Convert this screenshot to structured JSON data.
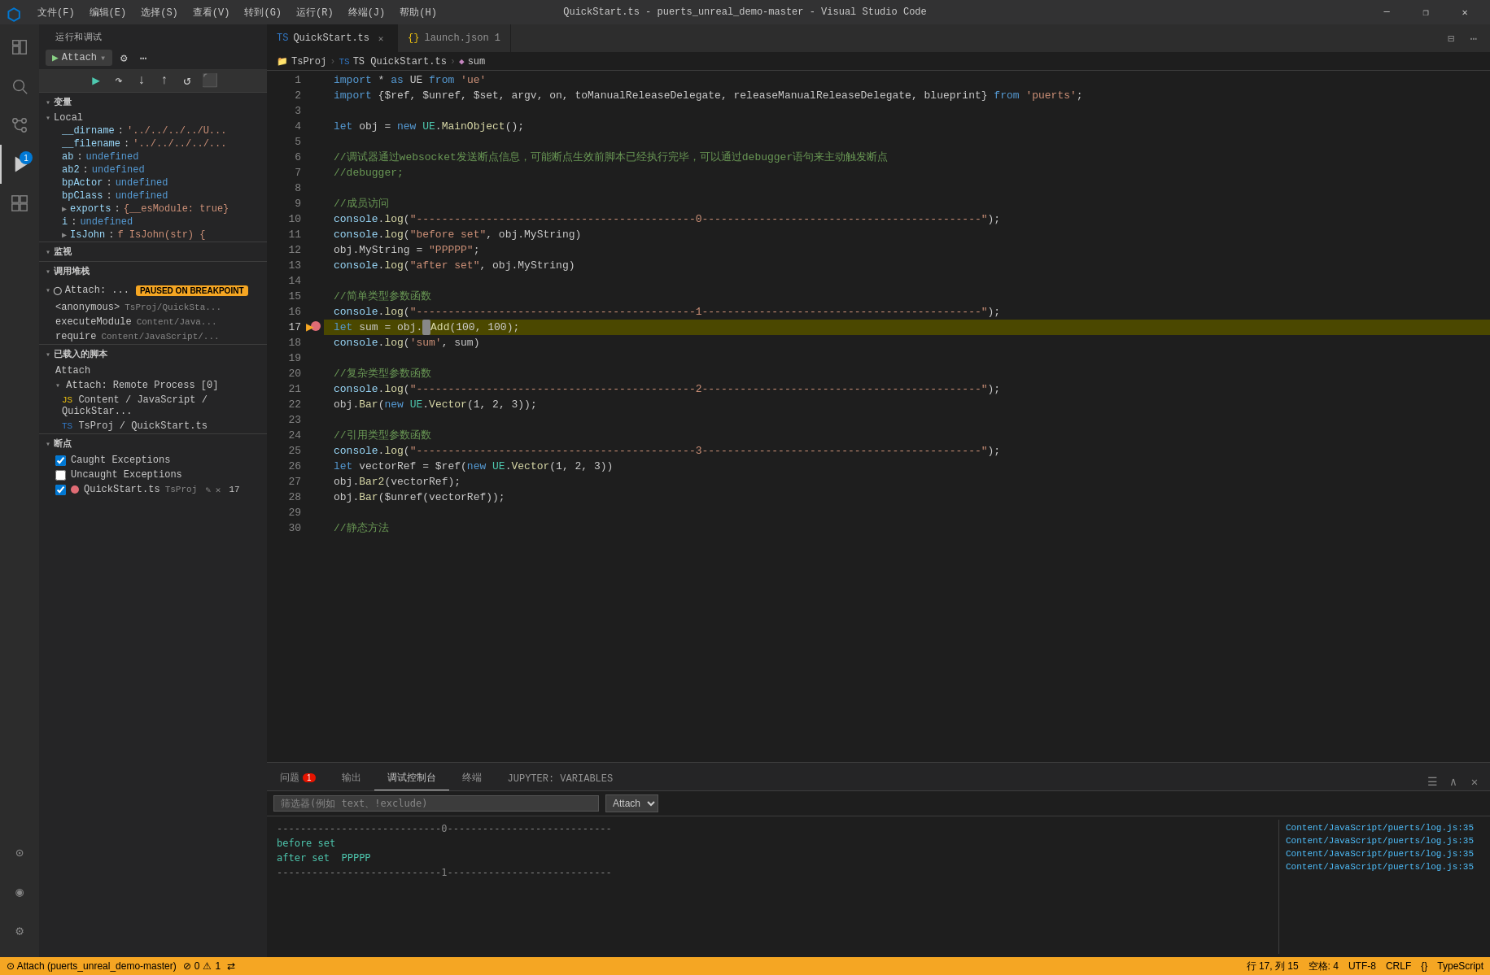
{
  "titleBar": {
    "title": "QuickStart.ts - puerts_unreal_demo-master - Visual Studio Code",
    "logo": "⬡",
    "menus": [
      "文件(F)",
      "编辑(E)",
      "选择(S)",
      "查看(V)",
      "转到(G)",
      "运行(R)",
      "终端(J)",
      "帮助(H)"
    ],
    "windowButtons": [
      "─",
      "❐",
      "✕"
    ]
  },
  "activityBar": {
    "icons": [
      {
        "name": "explorer-icon",
        "symbol": "⎘",
        "active": false
      },
      {
        "name": "search-icon",
        "symbol": "🔍",
        "active": false
      },
      {
        "name": "source-control-icon",
        "symbol": "⑂",
        "active": false
      },
      {
        "name": "run-debug-icon",
        "symbol": "▷",
        "active": true,
        "badge": "1"
      },
      {
        "name": "extensions-icon",
        "symbol": "⊞",
        "active": false
      }
    ],
    "bottomIcons": [
      {
        "name": "remote-icon",
        "symbol": "⊙"
      },
      {
        "name": "account-icon",
        "symbol": "◉"
      },
      {
        "name": "settings-icon",
        "symbol": "⚙"
      }
    ]
  },
  "sidebar": {
    "header": "运行和调试",
    "debugConfig": {
      "label": "Attach",
      "gearIcon": "⚙",
      "moreIcon": "⋯",
      "runIcon": "▶",
      "addIcon": "+"
    },
    "variables": {
      "sectionLabel": "变量",
      "local": {
        "label": "Local",
        "items": [
          {
            "name": "__dirname",
            "value": "'../../../../U..."
          },
          {
            "name": "__filename",
            "value": "'../../../../..."
          },
          {
            "name": "ab",
            "value": "undefined"
          },
          {
            "name": "ab2",
            "value": "undefined"
          },
          {
            "name": "bpActor",
            "value": "undefined"
          },
          {
            "name": "bpClass",
            "value": "undefined"
          },
          {
            "name": "exports",
            "value": "{__esModule: true}"
          },
          {
            "name": "i",
            "value": "undefined"
          },
          {
            "name": "IsJohn",
            "value": "f IsJohn(str) {"
          }
        ]
      }
    },
    "watch": {
      "sectionLabel": "监视"
    },
    "callStack": {
      "sectionLabel": "调用堆栈",
      "attach": {
        "label": "Attach:",
        "sublabel": "...",
        "badge": "PAUSED ON BREAKPOINT"
      },
      "frames": [
        {
          "name": "<anonymous>",
          "loc": "TsProj/QuickSta..."
        },
        {
          "name": "executeModule",
          "loc": "Content/Java..."
        },
        {
          "name": "require",
          "loc": "Content/JavaScript/..."
        }
      ]
    },
    "scriptsLoaded": {
      "sectionLabel": "已载入的脚本",
      "items": [
        {
          "label": "Attach",
          "indent": false
        },
        {
          "label": "Attach: Remote Process [0]",
          "indent": false,
          "expandable": true
        },
        {
          "label": "Content / JavaScript / QuickStar...",
          "indent": true,
          "icon": "JS"
        },
        {
          "label": "TsProj / QuickStart.ts",
          "indent": true,
          "icon": "TS"
        }
      ]
    },
    "breakpoints": {
      "sectionLabel": "断点",
      "items": [
        {
          "label": "Caught Exceptions",
          "checked": true
        },
        {
          "label": "Uncaught Exceptions",
          "checked": false
        },
        {
          "label": "QuickStart.ts  TsProj",
          "checked": true,
          "dot": true,
          "line": "17",
          "editIcon": "✎",
          "closeIcon": "✕"
        }
      ]
    }
  },
  "editor": {
    "tabs": [
      {
        "label": "QuickStart.ts",
        "type": "ts",
        "active": true,
        "dirty": false
      },
      {
        "label": "launch.json 1",
        "type": "json",
        "active": false,
        "dirty": false
      }
    ],
    "breadcrumb": [
      {
        "label": "TsProj"
      },
      {
        "label": "TS QuickStart.ts"
      },
      {
        "label": "sum",
        "icon": "◆"
      }
    ],
    "lines": [
      {
        "num": 1,
        "tokens": [
          {
            "t": "kw",
            "v": "import"
          },
          {
            "t": "punct",
            "v": " * "
          },
          {
            "t": "kw",
            "v": "as"
          },
          {
            "t": "punct",
            "v": " UE "
          },
          {
            "t": "kw",
            "v": "from"
          },
          {
            "t": "punct",
            "v": " "
          },
          {
            "t": "str",
            "v": "'ue'"
          }
        ]
      },
      {
        "num": 2,
        "tokens": [
          {
            "t": "kw",
            "v": "import"
          },
          {
            "t": "punct",
            "v": " {$ref, $unref, $set, argv, on, toManualReleaseDelegate, releaseManualReleaseDelegate, blueprint} "
          },
          {
            "t": "kw",
            "v": "from"
          },
          {
            "t": "punct",
            "v": " "
          },
          {
            "t": "str",
            "v": "'puerts'"
          },
          {
            "t": "punct",
            "v": ";"
          }
        ]
      },
      {
        "num": 3,
        "tokens": []
      },
      {
        "num": 4,
        "tokens": [
          {
            "t": "kw",
            "v": "let"
          },
          {
            "t": "punct",
            "v": " obj = "
          },
          {
            "t": "kw",
            "v": "new"
          },
          {
            "t": "punct",
            "v": " "
          },
          {
            "t": "type-ref",
            "v": "UE"
          },
          {
            "t": "punct",
            "v": "."
          },
          {
            "t": "fn",
            "v": "MainObject"
          },
          {
            "t": "punct",
            "v": "();"
          }
        ]
      },
      {
        "num": 5,
        "tokens": []
      },
      {
        "num": 6,
        "tokens": [
          {
            "t": "comment",
            "v": "//调试器通过websocket发送断点信息，可能断点生效前脚本已经执行完毕，可以通过debugger语句来主动触发断点"
          }
        ]
      },
      {
        "num": 7,
        "tokens": [
          {
            "t": "comment",
            "v": "//debugger;"
          }
        ]
      },
      {
        "num": 8,
        "tokens": []
      },
      {
        "num": 9,
        "tokens": [
          {
            "t": "comment",
            "v": "//成员访问"
          }
        ]
      },
      {
        "num": 10,
        "tokens": [
          {
            "t": "var-ref",
            "v": "console"
          },
          {
            "t": "punct",
            "v": "."
          },
          {
            "t": "fn",
            "v": "log"
          },
          {
            "t": "punct",
            "v": "("
          },
          {
            "t": "str",
            "v": "\"--------------------------------------------0--------------------------------------------\""
          },
          {
            "t": "punct",
            "v": ");"
          }
        ]
      },
      {
        "num": 11,
        "tokens": [
          {
            "t": "var-ref",
            "v": "console"
          },
          {
            "t": "punct",
            "v": "."
          },
          {
            "t": "fn",
            "v": "log"
          },
          {
            "t": "punct",
            "v": "("
          },
          {
            "t": "str",
            "v": "\"before set\""
          },
          {
            "t": "punct",
            "v": ", obj.MyString)"
          }
        ]
      },
      {
        "num": 12,
        "tokens": [
          {
            "t": "punct",
            "v": "obj.MyString = "
          },
          {
            "t": "str",
            "v": "\"PPPPP\""
          },
          {
            "t": "punct",
            "v": ";"
          }
        ]
      },
      {
        "num": 13,
        "tokens": [
          {
            "t": "var-ref",
            "v": "console"
          },
          {
            "t": "punct",
            "v": "."
          },
          {
            "t": "fn",
            "v": "log"
          },
          {
            "t": "punct",
            "v": "("
          },
          {
            "t": "str",
            "v": "\"after set\""
          },
          {
            "t": "punct",
            "v": ", obj.MyString)"
          }
        ]
      },
      {
        "num": 14,
        "tokens": []
      },
      {
        "num": 15,
        "tokens": [
          {
            "t": "comment",
            "v": "//简单类型参数函数"
          }
        ]
      },
      {
        "num": 16,
        "tokens": [
          {
            "t": "var-ref",
            "v": "console"
          },
          {
            "t": "punct",
            "v": "."
          },
          {
            "t": "fn",
            "v": "log"
          },
          {
            "t": "punct",
            "v": "("
          },
          {
            "t": "str",
            "v": "\"--------------------------------------------1--------------------------------------------\""
          },
          {
            "t": "punct",
            "v": ");"
          }
        ]
      },
      {
        "num": 17,
        "tokens": [
          {
            "t": "kw",
            "v": "let"
          },
          {
            "t": "punct",
            "v": " sum = obj."
          },
          {
            "t": "fn",
            "v": "Add"
          },
          {
            "t": "punct",
            "v": "(100, 100);"
          }
        ],
        "current": true,
        "debugArrow": true
      },
      {
        "num": 18,
        "tokens": [
          {
            "t": "var-ref",
            "v": "console"
          },
          {
            "t": "punct",
            "v": "."
          },
          {
            "t": "fn",
            "v": "log"
          },
          {
            "t": "punct",
            "v": "("
          },
          {
            "t": "str",
            "v": "'sum'"
          },
          {
            "t": "punct",
            "v": ", sum)"
          }
        ]
      },
      {
        "num": 19,
        "tokens": []
      },
      {
        "num": 20,
        "tokens": [
          {
            "t": "comment",
            "v": "//复杂类型参数函数"
          }
        ]
      },
      {
        "num": 21,
        "tokens": [
          {
            "t": "var-ref",
            "v": "console"
          },
          {
            "t": "punct",
            "v": "."
          },
          {
            "t": "fn",
            "v": "log"
          },
          {
            "t": "punct",
            "v": "("
          },
          {
            "t": "str",
            "v": "\"--------------------------------------------2--------------------------------------------\""
          },
          {
            "t": "punct",
            "v": ");"
          }
        ]
      },
      {
        "num": 22,
        "tokens": [
          {
            "t": "punct",
            "v": "obj."
          },
          {
            "t": "fn",
            "v": "Bar"
          },
          {
            "t": "punct",
            "v": "("
          },
          {
            "t": "kw",
            "v": "new"
          },
          {
            "t": "punct",
            "v": " "
          },
          {
            "t": "type-ref",
            "v": "UE"
          },
          {
            "t": "punct",
            "v": "."
          },
          {
            "t": "fn",
            "v": "Vector"
          },
          {
            "t": "punct",
            "v": "(1, 2, 3));"
          }
        ]
      },
      {
        "num": 23,
        "tokens": []
      },
      {
        "num": 24,
        "tokens": [
          {
            "t": "comment",
            "v": "//引用类型参数函数"
          }
        ]
      },
      {
        "num": 25,
        "tokens": [
          {
            "t": "var-ref",
            "v": "console"
          },
          {
            "t": "punct",
            "v": "."
          },
          {
            "t": "fn",
            "v": "log"
          },
          {
            "t": "punct",
            "v": "("
          },
          {
            "t": "str",
            "v": "\"--------------------------------------------3--------------------------------------------\""
          },
          {
            "t": "punct",
            "v": ");"
          }
        ]
      },
      {
        "num": 26,
        "tokens": [
          {
            "t": "kw",
            "v": "let"
          },
          {
            "t": "punct",
            "v": " vectorRef = $ref("
          },
          {
            "t": "kw",
            "v": "new"
          },
          {
            "t": "punct",
            "v": " "
          },
          {
            "t": "type-ref",
            "v": "UE"
          },
          {
            "t": "punct",
            "v": "."
          },
          {
            "t": "fn",
            "v": "Vector"
          },
          {
            "t": "punct",
            "v": "(1, 2, 3))"
          }
        ]
      },
      {
        "num": 27,
        "tokens": [
          {
            "t": "punct",
            "v": "obj."
          },
          {
            "t": "fn",
            "v": "Bar2"
          },
          {
            "t": "punct",
            "v": "(vectorRef);"
          }
        ]
      },
      {
        "num": 28,
        "tokens": [
          {
            "t": "punct",
            "v": "obj."
          },
          {
            "t": "fn",
            "v": "Bar"
          },
          {
            "t": "punct",
            "v": "($unref(vectorRef));"
          }
        ]
      },
      {
        "num": 29,
        "tokens": []
      },
      {
        "num": 30,
        "tokens": [
          {
            "t": "comment",
            "v": "//静态方法"
          }
        ]
      }
    ]
  },
  "panel": {
    "tabs": [
      {
        "label": "问题",
        "badge": "1",
        "active": false
      },
      {
        "label": "输出",
        "active": false
      },
      {
        "label": "调试控制台",
        "active": true
      },
      {
        "label": "终端",
        "active": false
      },
      {
        "label": "JUPYTER: VARIABLES",
        "active": false
      }
    ],
    "filterPlaceholder": "筛选器(例如 text、!exclude)",
    "filterConfig": "Attach",
    "terminalLines": [
      {
        "text": "----------------------------0----------------------------",
        "class": "separator"
      },
      {
        "text": "before set",
        "class": "green"
      },
      {
        "text": "after set  PPPPP",
        "class": "green"
      },
      {
        "text": "----------------------------1----------------------------",
        "class": "separator"
      }
    ],
    "logRefs": [
      "Content/JavaScript/puerts/log.js:35",
      "Content/JavaScript/puerts/log.js:35",
      "Content/JavaScript/puerts/log.js:35",
      "Content/JavaScript/puerts/log.js:35"
    ]
  },
  "statusBar": {
    "debugInfo": "⊙ Attach (puerts_unreal_demo-master)",
    "errors": "⊘ 0",
    "warnings": "⚠ 1",
    "syncIcon": "⇄",
    "row": "行 17, 列 15",
    "spaces": "空格: 4",
    "encoding": "UTF-8",
    "lineEnding": "CRLF",
    "language": "TypeScript",
    "braceIcon": "{}"
  }
}
